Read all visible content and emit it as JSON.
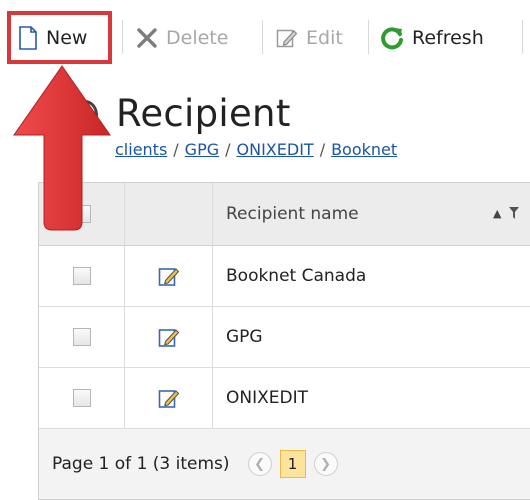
{
  "toolbar": {
    "new_label": "New",
    "delete_label": "Delete",
    "edit_label": "Edit",
    "refresh_label": "Refresh"
  },
  "page": {
    "title": "Recipient"
  },
  "breadcrumb": [
    "clients",
    "GPG",
    "ONIXEDIT",
    "Booknet"
  ],
  "grid": {
    "column_header": "Recipient name",
    "rows": [
      {
        "name": "Booknet Canada"
      },
      {
        "name": "GPG"
      },
      {
        "name": "ONIXEDIT"
      }
    ]
  },
  "pager": {
    "summary": "Page 1 of 1 (3 items)",
    "current_page": "1",
    "prev_icon": "chevron-left-icon",
    "next_icon": "chevron-right-icon"
  },
  "colors": {
    "highlight": "#d9383a",
    "arrow": "#e0393b",
    "link": "#1a55a8",
    "current_page_bg": "#fde39c",
    "refresh_icon": "#2f9a2f"
  }
}
